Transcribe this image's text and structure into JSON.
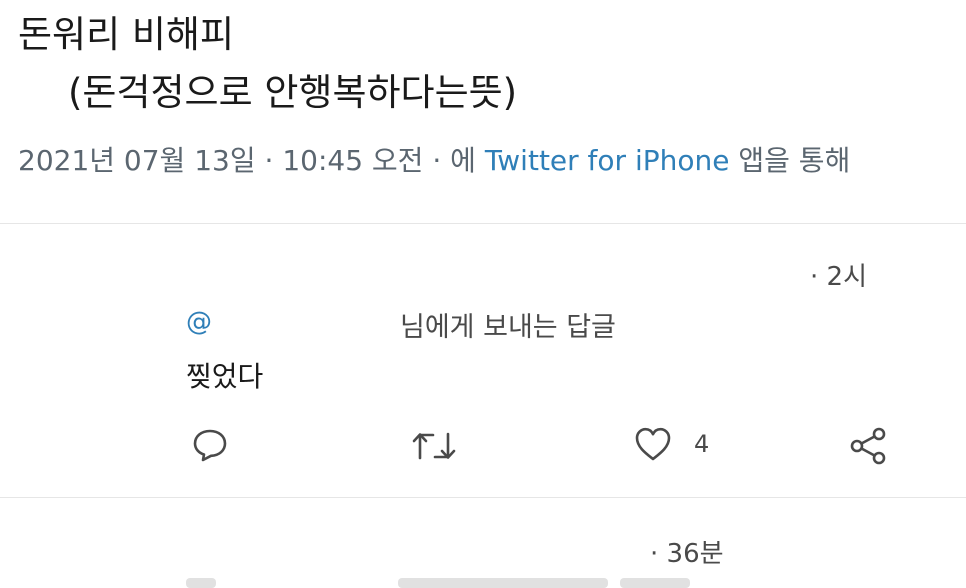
{
  "tweet": {
    "line1": "돈워리 비해피",
    "line2": "(돈걱정으로 안행복하다는뜻)",
    "date": "2021년 07월 13일",
    "separator": " · ",
    "time": "10:45 오전",
    "via_prefix": "에 ",
    "via_app": "Twitter for iPhone",
    "via_suffix": " 앱을 통해"
  },
  "replies": [
    {
      "time": "· 2시",
      "mention": "@",
      "reply_to": "님에게 보내는 답글",
      "text": "찢었다",
      "like_count": "4"
    },
    {
      "time": "· 36분"
    }
  ],
  "icons": {
    "reply": "speech-bubble-icon",
    "retweet": "retweet-icon",
    "like": "heart-icon",
    "share": "share-icon"
  },
  "colors": {
    "link": "#2f7fb8",
    "meta": "#5b6670",
    "text": "#1a1a1a",
    "divider": "#e6e6e6"
  }
}
